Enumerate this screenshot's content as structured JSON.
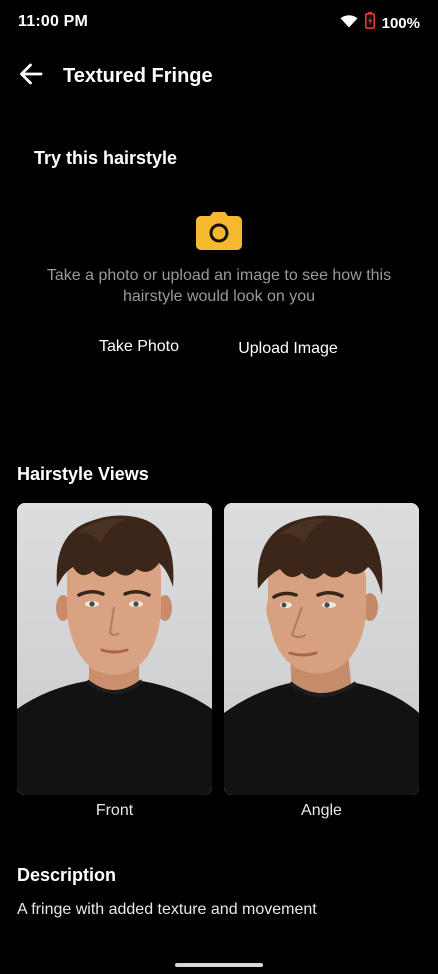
{
  "status_bar": {
    "time": "11:00 PM",
    "battery": "100%",
    "icons": [
      "wifi-icon",
      "battery-icon"
    ]
  },
  "app_bar": {
    "title": "Textured Fringe",
    "back_icon": "arrow-left-icon"
  },
  "try_section": {
    "title": "Try this hairstyle",
    "icon": "camera-icon",
    "icon_color": "#F5B82E",
    "description": "Take a photo or upload an image to see how this hairstyle would look on you",
    "take_photo_label": "Take Photo",
    "upload_label": "Upload Image"
  },
  "views": {
    "heading": "Hairstyle Views",
    "items": [
      {
        "label": "Front"
      },
      {
        "label": "Angle"
      }
    ]
  },
  "description": {
    "heading": "Description",
    "text": "A fringe with added texture and movement"
  },
  "colors": {
    "background": "#000000",
    "text": "#FFFFFF",
    "muted_text": "#9A9A9A",
    "accent": "#F5B82E"
  }
}
